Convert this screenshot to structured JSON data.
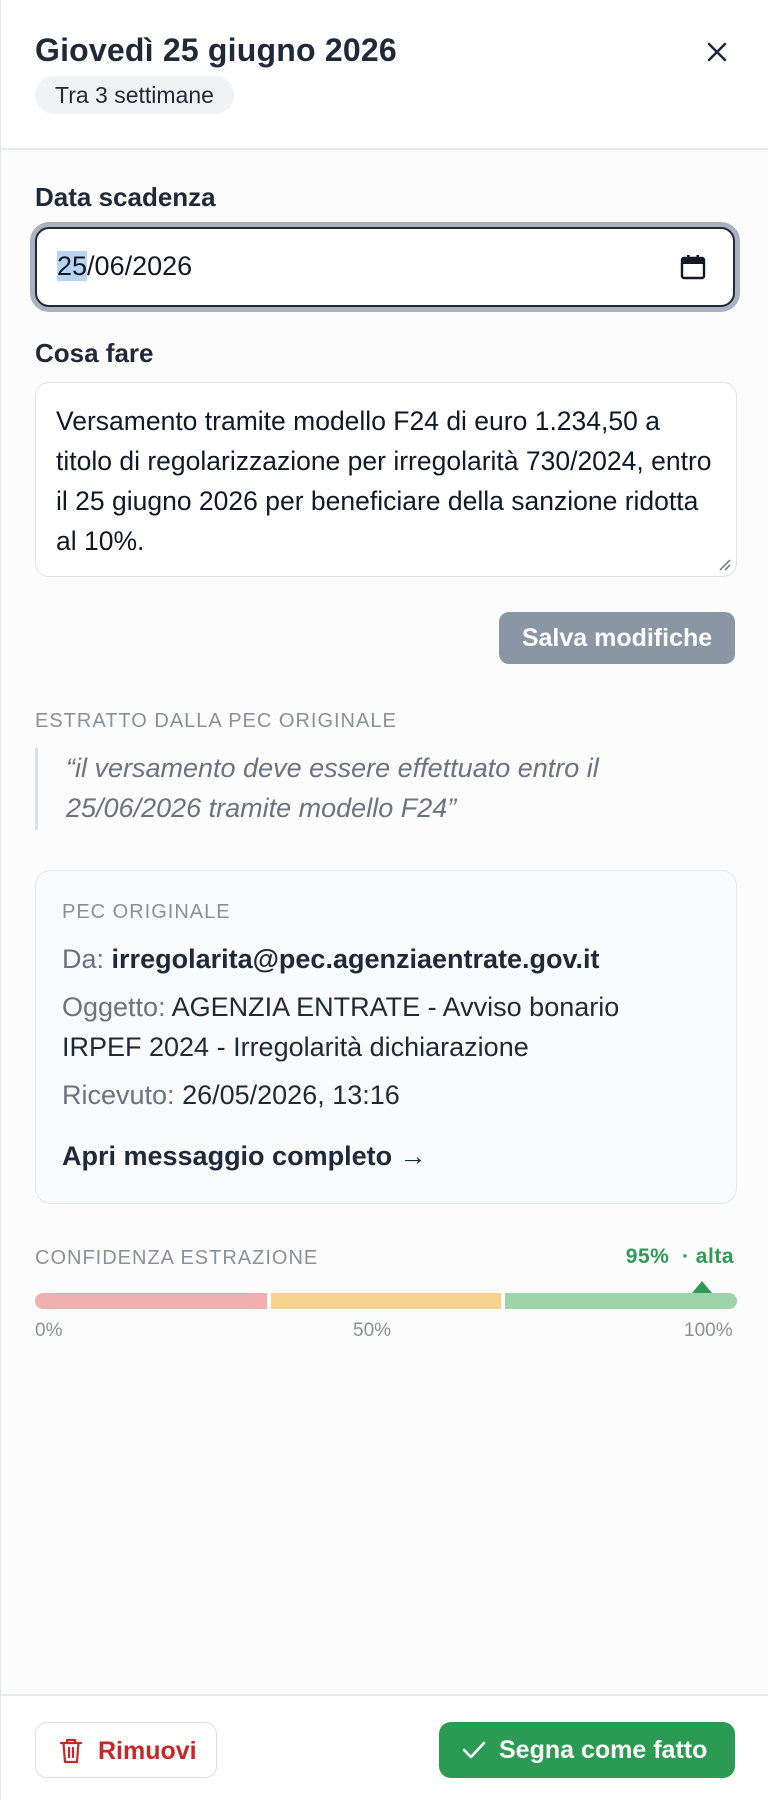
{
  "header": {
    "title": "Giovedì 25 giugno 2026",
    "relative": "Tra 3 settimane"
  },
  "due_date": {
    "label": "Data scadenza",
    "day": "25",
    "rest": "/06/2026"
  },
  "task": {
    "label": "Cosa fare",
    "text": "Versamento tramite modello F24 di euro 1.234,50 a titolo di regolarizzazione per irregolarità 730/2024, entro il 25 giugno 2026 per beneficiare della sanzione ridotta al 10%."
  },
  "save_label": "Salva modifiche",
  "excerpt": {
    "heading": "ESTRATTO DALLA PEC ORIGINALE",
    "quote": "“il versamento deve essere effettuato entro il 25/06/2026 tramite modello F24”"
  },
  "pec": {
    "heading": "PEC ORIGINALE",
    "from_label": "Da:",
    "from": "irregolarita@pec.agenziaentrate.gov.it",
    "subject_label": "Oggetto:",
    "subject": "AGENZIA ENTRATE - Avviso bonario IRPEF 2024 - Irregolarità dichiarazione",
    "received_label": "Ricevuto:",
    "received": "26/05/2026, 13:16",
    "open_link": "Apri messaggio completo →"
  },
  "confidence": {
    "heading": "CONFIDENZA ESTRAZIONE",
    "percent": "95%",
    "level": "· alta",
    "value": 0.95,
    "ticks": [
      "0%",
      "50%",
      "100%"
    ]
  },
  "footer": {
    "remove_label": "Rimuovi",
    "done_label": "Segna come fatto"
  },
  "colors": {
    "accent_green": "#2b9a52",
    "danger_red": "#c62828"
  },
  "icons": [
    "close-icon",
    "calendar-icon",
    "resize-handle-icon",
    "trash-icon",
    "check-icon"
  ]
}
